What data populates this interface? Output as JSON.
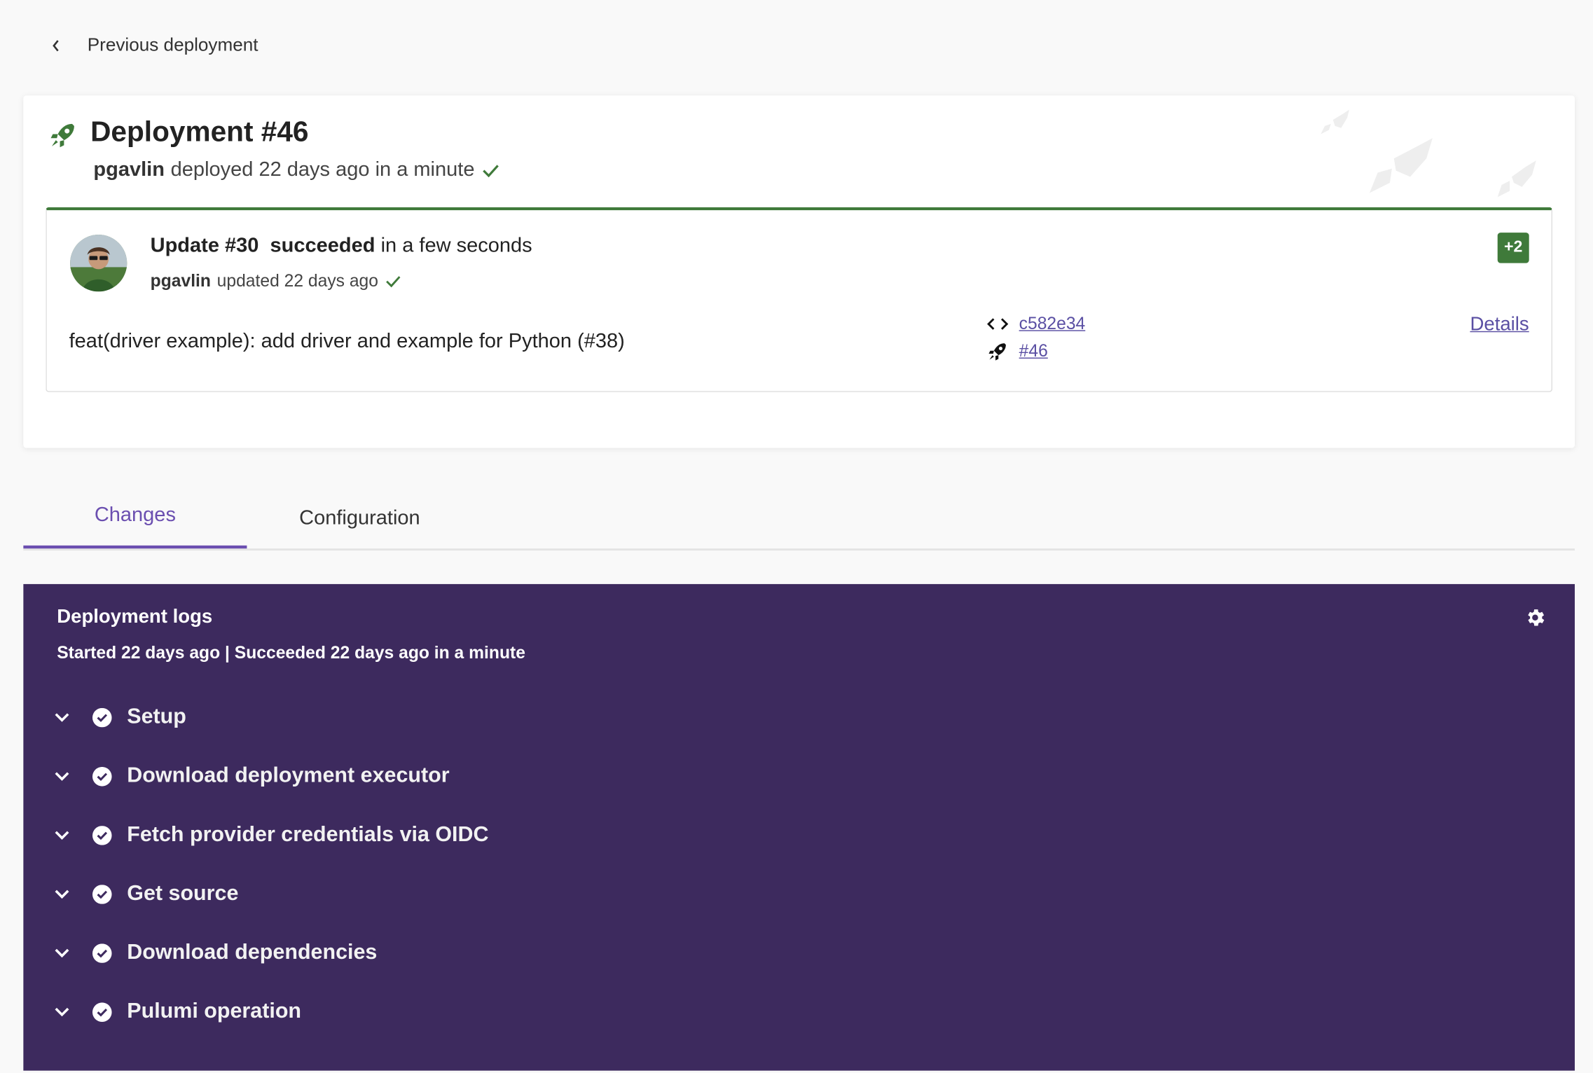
{
  "nav": {
    "back_label": "Previous deployment"
  },
  "deployment": {
    "title": "Deployment #46",
    "user": "pgavlin",
    "summary": "deployed 22 days ago in a minute"
  },
  "update": {
    "title": "Update #30",
    "status": "succeeded",
    "duration": "in a few seconds",
    "user": "pgavlin",
    "summary": "updated 22 days ago",
    "badge": "+2",
    "commit_message": "feat(driver example): add driver and example for Python (#38)",
    "commit_sha": "c582e34",
    "deployment_ref": "#46",
    "details_label": "Details"
  },
  "tabs": [
    {
      "label": "Changes",
      "active": true
    },
    {
      "label": "Configuration",
      "active": false
    }
  ],
  "logs": {
    "title": "Deployment logs",
    "subtitle": "Started 22 days ago | Succeeded 22 days ago in a minute",
    "steps": [
      {
        "label": "Setup"
      },
      {
        "label": "Download deployment executor"
      },
      {
        "label": "Fetch provider credentials via OIDC"
      },
      {
        "label": "Get source"
      },
      {
        "label": "Download dependencies"
      },
      {
        "label": "Pulumi operation"
      }
    ]
  },
  "colors": {
    "success": "#3f7a3a",
    "accent": "#6b4fb0",
    "logs_bg": "#3d2a5e",
    "link": "#5a4fa3"
  },
  "icons": [
    "chevron-left-icon",
    "rocket-icon",
    "check-icon",
    "code-icon",
    "gear-icon",
    "chevron-down-icon",
    "check-circle-icon"
  ]
}
